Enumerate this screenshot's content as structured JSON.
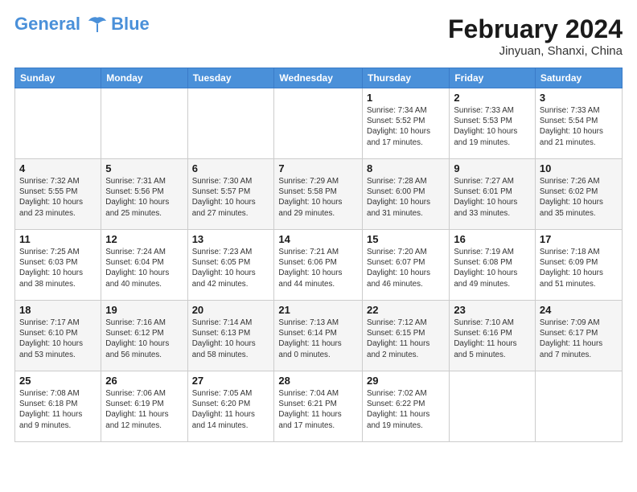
{
  "header": {
    "logo_line1": "General",
    "logo_line2": "Blue",
    "month_title": "February 2024",
    "location": "Jinyuan, Shanxi, China"
  },
  "weekdays": [
    "Sunday",
    "Monday",
    "Tuesday",
    "Wednesday",
    "Thursday",
    "Friday",
    "Saturday"
  ],
  "weeks": [
    [
      {
        "day": "",
        "info": ""
      },
      {
        "day": "",
        "info": ""
      },
      {
        "day": "",
        "info": ""
      },
      {
        "day": "",
        "info": ""
      },
      {
        "day": "1",
        "info": "Sunrise: 7:34 AM\nSunset: 5:52 PM\nDaylight: 10 hours\nand 17 minutes."
      },
      {
        "day": "2",
        "info": "Sunrise: 7:33 AM\nSunset: 5:53 PM\nDaylight: 10 hours\nand 19 minutes."
      },
      {
        "day": "3",
        "info": "Sunrise: 7:33 AM\nSunset: 5:54 PM\nDaylight: 10 hours\nand 21 minutes."
      }
    ],
    [
      {
        "day": "4",
        "info": "Sunrise: 7:32 AM\nSunset: 5:55 PM\nDaylight: 10 hours\nand 23 minutes."
      },
      {
        "day": "5",
        "info": "Sunrise: 7:31 AM\nSunset: 5:56 PM\nDaylight: 10 hours\nand 25 minutes."
      },
      {
        "day": "6",
        "info": "Sunrise: 7:30 AM\nSunset: 5:57 PM\nDaylight: 10 hours\nand 27 minutes."
      },
      {
        "day": "7",
        "info": "Sunrise: 7:29 AM\nSunset: 5:58 PM\nDaylight: 10 hours\nand 29 minutes."
      },
      {
        "day": "8",
        "info": "Sunrise: 7:28 AM\nSunset: 6:00 PM\nDaylight: 10 hours\nand 31 minutes."
      },
      {
        "day": "9",
        "info": "Sunrise: 7:27 AM\nSunset: 6:01 PM\nDaylight: 10 hours\nand 33 minutes."
      },
      {
        "day": "10",
        "info": "Sunrise: 7:26 AM\nSunset: 6:02 PM\nDaylight: 10 hours\nand 35 minutes."
      }
    ],
    [
      {
        "day": "11",
        "info": "Sunrise: 7:25 AM\nSunset: 6:03 PM\nDaylight: 10 hours\nand 38 minutes."
      },
      {
        "day": "12",
        "info": "Sunrise: 7:24 AM\nSunset: 6:04 PM\nDaylight: 10 hours\nand 40 minutes."
      },
      {
        "day": "13",
        "info": "Sunrise: 7:23 AM\nSunset: 6:05 PM\nDaylight: 10 hours\nand 42 minutes."
      },
      {
        "day": "14",
        "info": "Sunrise: 7:21 AM\nSunset: 6:06 PM\nDaylight: 10 hours\nand 44 minutes."
      },
      {
        "day": "15",
        "info": "Sunrise: 7:20 AM\nSunset: 6:07 PM\nDaylight: 10 hours\nand 46 minutes."
      },
      {
        "day": "16",
        "info": "Sunrise: 7:19 AM\nSunset: 6:08 PM\nDaylight: 10 hours\nand 49 minutes."
      },
      {
        "day": "17",
        "info": "Sunrise: 7:18 AM\nSunset: 6:09 PM\nDaylight: 10 hours\nand 51 minutes."
      }
    ],
    [
      {
        "day": "18",
        "info": "Sunrise: 7:17 AM\nSunset: 6:10 PM\nDaylight: 10 hours\nand 53 minutes."
      },
      {
        "day": "19",
        "info": "Sunrise: 7:16 AM\nSunset: 6:12 PM\nDaylight: 10 hours\nand 56 minutes."
      },
      {
        "day": "20",
        "info": "Sunrise: 7:14 AM\nSunset: 6:13 PM\nDaylight: 10 hours\nand 58 minutes."
      },
      {
        "day": "21",
        "info": "Sunrise: 7:13 AM\nSunset: 6:14 PM\nDaylight: 11 hours\nand 0 minutes."
      },
      {
        "day": "22",
        "info": "Sunrise: 7:12 AM\nSunset: 6:15 PM\nDaylight: 11 hours\nand 2 minutes."
      },
      {
        "day": "23",
        "info": "Sunrise: 7:10 AM\nSunset: 6:16 PM\nDaylight: 11 hours\nand 5 minutes."
      },
      {
        "day": "24",
        "info": "Sunrise: 7:09 AM\nSunset: 6:17 PM\nDaylight: 11 hours\nand 7 minutes."
      }
    ],
    [
      {
        "day": "25",
        "info": "Sunrise: 7:08 AM\nSunset: 6:18 PM\nDaylight: 11 hours\nand 9 minutes."
      },
      {
        "day": "26",
        "info": "Sunrise: 7:06 AM\nSunset: 6:19 PM\nDaylight: 11 hours\nand 12 minutes."
      },
      {
        "day": "27",
        "info": "Sunrise: 7:05 AM\nSunset: 6:20 PM\nDaylight: 11 hours\nand 14 minutes."
      },
      {
        "day": "28",
        "info": "Sunrise: 7:04 AM\nSunset: 6:21 PM\nDaylight: 11 hours\nand 17 minutes."
      },
      {
        "day": "29",
        "info": "Sunrise: 7:02 AM\nSunset: 6:22 PM\nDaylight: 11 hours\nand 19 minutes."
      },
      {
        "day": "",
        "info": ""
      },
      {
        "day": "",
        "info": ""
      }
    ]
  ]
}
